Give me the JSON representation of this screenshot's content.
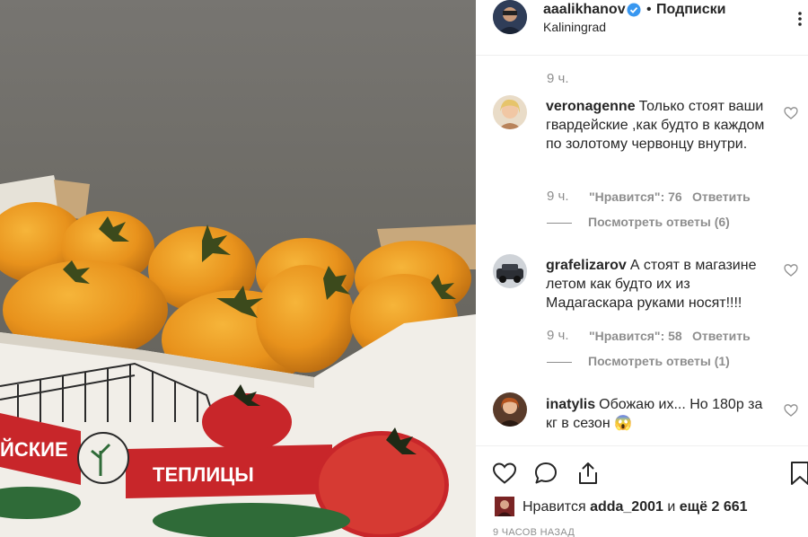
{
  "header": {
    "username": "aaalikhanov",
    "separator": "•",
    "follow_label": "Подписки",
    "location": "Kaliningrad"
  },
  "caption_time": "9 ч.",
  "box_print": {
    "left_word": "ЙСКИЕ",
    "brand_word": "ТЕПЛИЦЫ"
  },
  "comments": [
    {
      "user": "veronagenne",
      "text": "Только стоят ваши гвардейские ,как будто в каждом по золотому червонцу внутри.",
      "time": "9 ч.",
      "likes": "\"Нравится\": 76",
      "reply": "Ответить",
      "view_replies": "Посмотреть ответы (6)"
    },
    {
      "user": "grafelizarov",
      "text": "А стоят в магазине летом как будто их из Мадагаскара руками носят!!!!",
      "time": "9 ч.",
      "likes": "\"Нравится\": 58",
      "reply": "Ответить",
      "view_replies": "Посмотреть ответы (1)"
    },
    {
      "user": "inatylis",
      "text": "Обожаю их... Но 180р за кг в сезон 😱"
    }
  ],
  "likes_bar": {
    "prefix": "Нравится",
    "liker": "adda_2001",
    "middle": "и",
    "others": "ещё 2 661"
  },
  "posted_ago": "9 ЧАСОВ НАЗАД",
  "colors": {
    "verified": "#3897f0",
    "secondary_text": "#8e8e8e",
    "primary_text": "#262626",
    "divider": "#efefef"
  }
}
